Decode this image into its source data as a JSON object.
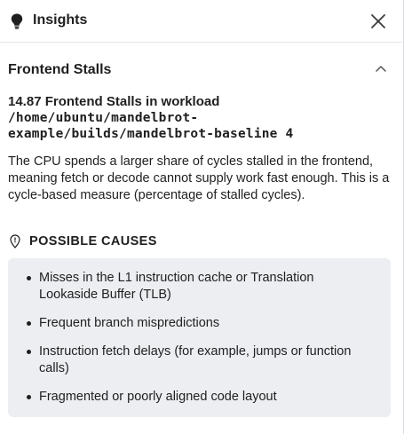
{
  "header": {
    "title": "Insights",
    "icon": "lightbulb-icon",
    "close_icon": "close-icon"
  },
  "section": {
    "title": "Frontend Stalls",
    "collapse_icon": "chevron-up-icon"
  },
  "metric": {
    "line1": "14.87 Frontend Stalls in workload",
    "path_line1": "/home/ubuntu/mandelbrot-",
    "path_line2": "example/builds/mandelbrot-baseline 4"
  },
  "description": "The CPU spends a larger share of cycles stalled in the frontend, meaning fetch or decode cannot supply work fast enough. This is a cycle-based measure (percentage of stalled cycles).",
  "causes": {
    "title": "POSSIBLE CAUSES",
    "icon": "location-pin-icon",
    "items": [
      "Misses in the L1 instruction cache or Translation Lookaside Buffer (TLB)",
      "Frequent branch mispredictions",
      "Instruction fetch delays (for example, jumps or function calls)",
      "Fragmented or poorly aligned code layout"
    ]
  },
  "colors": {
    "causes_background": "#eceef1",
    "text": "#1f1f1f",
    "divider": "#e3e6ea"
  }
}
